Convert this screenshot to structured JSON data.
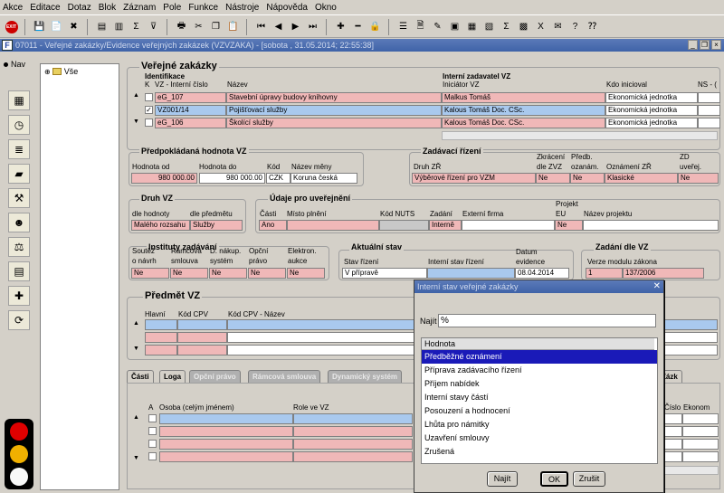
{
  "menu": [
    "Akce",
    "Editace",
    "Dotaz",
    "Blok",
    "Záznam",
    "Pole",
    "Funkce",
    "Nástroje",
    "Nápověda",
    "Okno"
  ],
  "toolbar": {
    "exit_label": "EXIT"
  },
  "window": {
    "title": "07011 - Veřejné zakázky/Evidence veřejných zakázek (VZVZAKA) - [sobota , 31.05.2014; 22:55:38]"
  },
  "nav": {
    "label": "Nav",
    "tree_root": "Vše"
  },
  "vz": {
    "title": "Veřejné zakázky",
    "identifikace": "Identifikace",
    "col_k": "K",
    "col_vz": "VZ - Interní číslo",
    "col_nazev": "Název",
    "interni_zadavatel": "Interní zadavatel VZ",
    "col_iniciator": "Iniciátor VZ",
    "col_kdo": "Kdo inicioval",
    "col_ns": "NS - (",
    "rows": [
      {
        "vz": "eG_107",
        "nazev": "Stavební úpravy budovy knihovny",
        "iniciator": "Malkus Tomáš",
        "kdo": "Ekonomická jednotka",
        "checked": false
      },
      {
        "vz": "VZ001/14",
        "nazev": "Pojišťovací služby",
        "iniciator": "Kalous Tomáš Doc. CSc.",
        "kdo": "Ekonomická jednotka",
        "checked": true
      },
      {
        "vz": "eG_106",
        "nazev": "Školící služby",
        "iniciator": "Kalous Tomáš Doc. CSc.",
        "kdo": "Ekonomická jednotka",
        "checked": false
      }
    ]
  },
  "hodnota": {
    "title": "Předpokládaná hodnota VZ",
    "od_label": "Hodnota od",
    "do_label": "Hodnota do",
    "kod_label": "Kód",
    "mena_label": "Název měny",
    "od": "980 000.00",
    "do": "980 000.00",
    "kod": "CZK",
    "mena": "Koruna česká"
  },
  "zadavaci": {
    "title": "Zadávací řízení",
    "druh_label": "Druh ZŘ",
    "zkraceni_label1": "Zkrácení",
    "zkraceni_label2": "dle ZVZ",
    "predb_label1": "Předb.",
    "predb_label2": "ozanám.",
    "oznameni_label": "Oznámení ZŘ",
    "zd_label1": "ZD",
    "zd_label2": "uveřej.",
    "druh": "Výběrové řízení pro VZM",
    "zkraceni": "Ne",
    "predb": "Ne",
    "oznameni": "Klasické",
    "zd": "Ne"
  },
  "druhvz": {
    "title": "Druh VZ",
    "hodnoty_label": "dle hodnoty",
    "predmetu_label": "dle předmětu",
    "hodnoty": "Malého rozsahu",
    "predmetu": "Služby"
  },
  "uverejneni": {
    "title": "Údaje pro uveřejnění",
    "casti_label": "Části",
    "misto_label": "Místo plnění",
    "nuts_label": "Kód NUTS",
    "zadani_label": "Zadání",
    "firma_label": "Externí firma",
    "projekt_label1": "Projekt",
    "projekt_label2": "EU",
    "nazev_proj_label": "Název projektu",
    "casti": "Ano",
    "zadani": "Interně",
    "projekt": "Ne"
  },
  "instituty": {
    "title": "Instituty zadávání",
    "soutez1": "Soutěž",
    "soutez2": "o návrh",
    "ramcova1": "Rámcová",
    "ramcova2": "smlouva",
    "dnakup1": "D. nákup.",
    "dnakup2": "systém",
    "opcni1": "Opční",
    "opcni2": "právo",
    "elektron1": "Elektron.",
    "elektron2": "aukce",
    "values": [
      "Ne",
      "Ne",
      "Ne",
      "Ne",
      "Ne"
    ]
  },
  "stav": {
    "title": "Aktuální stav",
    "stav_label": "Stav řízení",
    "interni_label": "Interní stav řízení",
    "datum_label1": "Datum",
    "datum_label2": "evidence",
    "stav": "V přípravě",
    "datum": "08.04.2014"
  },
  "zadani_vz": {
    "title": "Zadání dle VZ",
    "verze_label": "Verze modulu zákona",
    "verze": "1",
    "zakon": "137/2006"
  },
  "predmet": {
    "title": "Předmět VZ",
    "hlavni_label": "Hlavní",
    "kod_label": "Kód CPV",
    "nazev_label": "Kód CPV - Název"
  },
  "tabs": [
    "Části",
    "Loga",
    "Opční právo",
    "Rámcová smlouva",
    "Dynamický systém",
    "Zázk"
  ],
  "osoby": {
    "a_label": "A",
    "osoba_label": "Osoba (celým jménem)",
    "role_label": "Role ve VZ",
    "cislo_label": "Číslo",
    "ekonom_label": "Ekonom"
  },
  "dialog": {
    "title": "Interní stav veřejné zakázky",
    "najit_label": "Najít",
    "search_value": "%",
    "col_header": "Hodnota",
    "items": [
      "Předběžné oznámení",
      "Příprava zadávacího řízení",
      "Příjem nabídek",
      "Interní stavy částí",
      "Posouzení a hodnocení",
      "Lhůta pro námitky",
      "Uzavření smlouvy",
      "Zrušená"
    ],
    "find_button": "Najít",
    "ok_button": "OK",
    "cancel_button": "Zrušit"
  }
}
